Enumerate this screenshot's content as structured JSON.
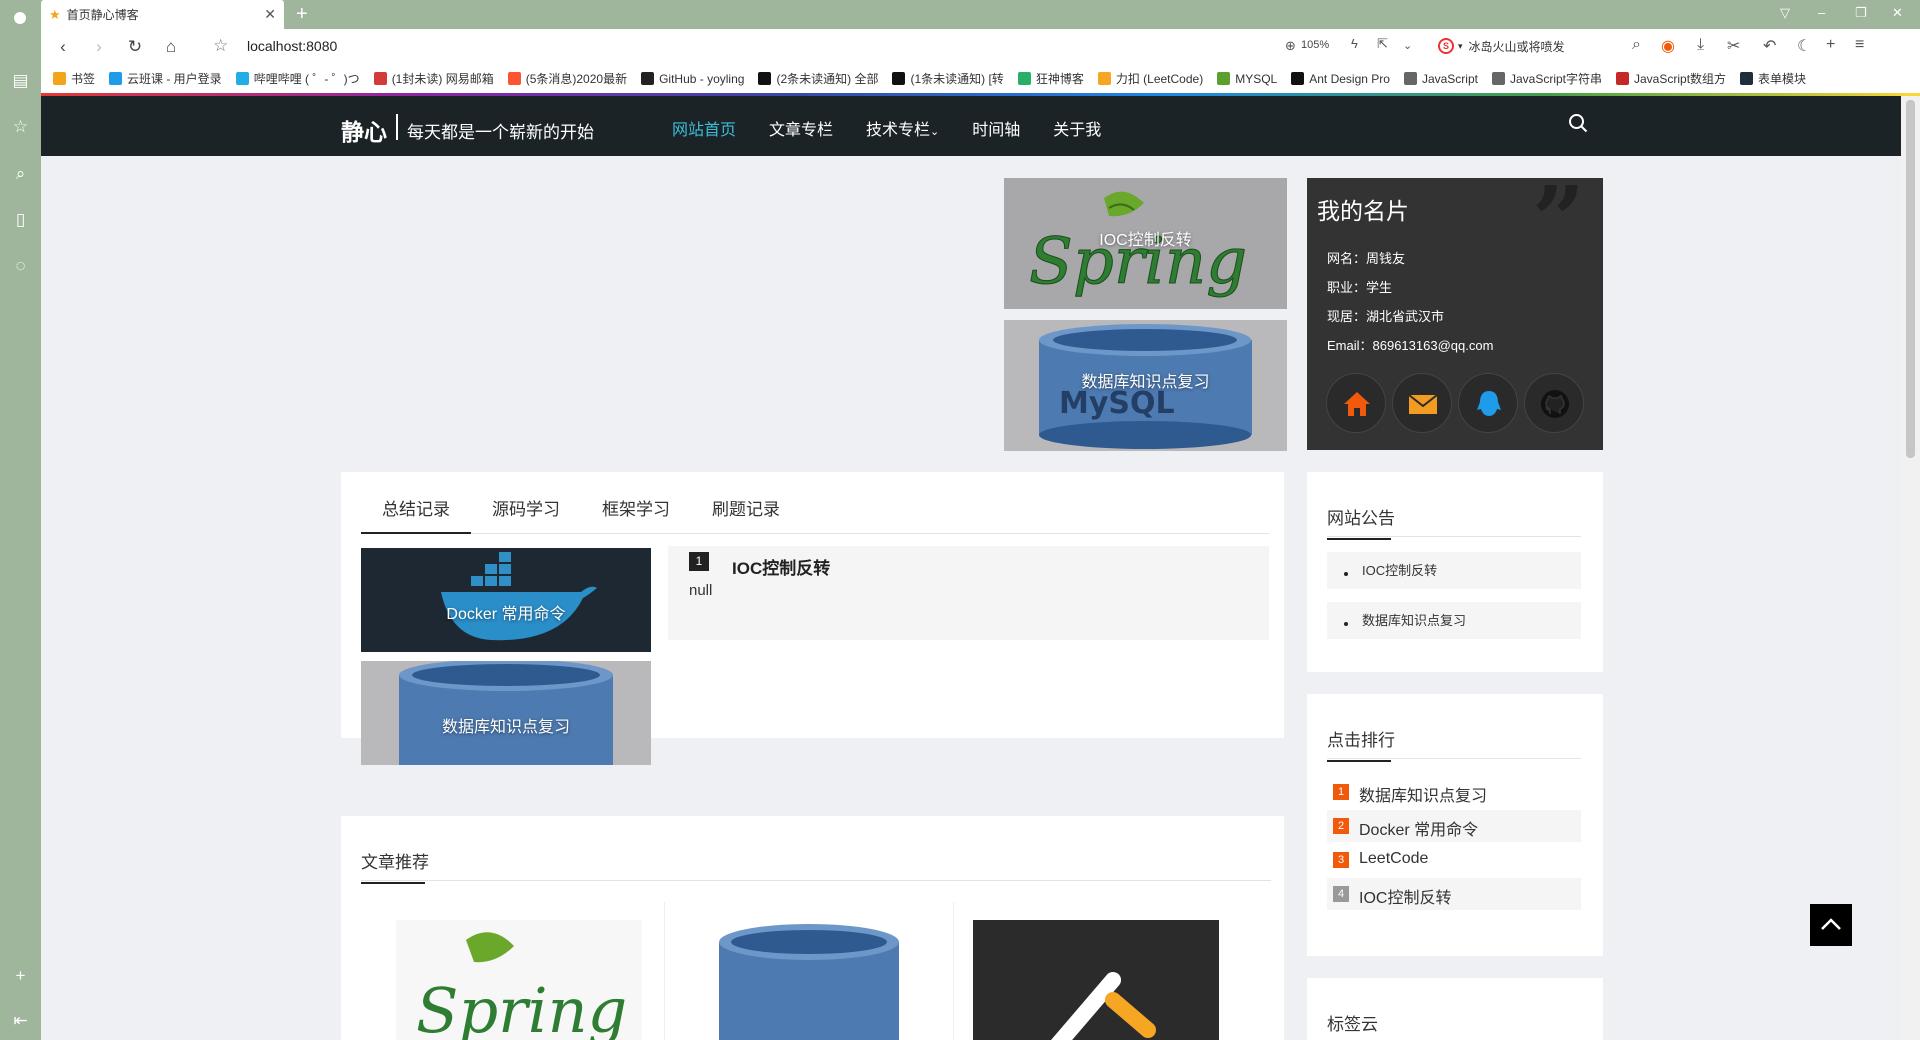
{
  "browser": {
    "tab_title": "首页静心博客",
    "url": "localhost:8080",
    "zoom": "105%",
    "search_engine_text": "冰岛火山或将喷发",
    "bookmarks": [
      {
        "label": "书签",
        "color": "#f2a51a"
      },
      {
        "label": "云班课 - 用户登录",
        "color": "#1e9be9"
      },
      {
        "label": "哔哩哔哩 ( ゜- ゜)つ",
        "color": "#23ade5"
      },
      {
        "label": "(1封未读) 网易邮箱",
        "color": "#d23b38"
      },
      {
        "label": "(5条消息)2020最新",
        "color": "#fc5531"
      },
      {
        "label": "GitHub - yoyling",
        "color": "#222222"
      },
      {
        "label": "(2条未读通知) 全部",
        "color": "#111111"
      },
      {
        "label": "(1条未读通知) [转",
        "color": "#111111"
      },
      {
        "label": "狂神博客",
        "color": "#2aae67"
      },
      {
        "label": "力扣 (LeetCode)",
        "color": "#f5a623"
      },
      {
        "label": "MYSQL",
        "color": "#5aa02c"
      },
      {
        "label": "Ant Design Pro",
        "color": "#111111"
      },
      {
        "label": "JavaScript",
        "color": "#666666"
      },
      {
        "label": "JavaScript字符串",
        "color": "#666666"
      },
      {
        "label": "JavaScript数组方",
        "color": "#c62828"
      },
      {
        "label": "表单模块",
        "color": "#1f2d3d"
      }
    ]
  },
  "site": {
    "brand": "静心",
    "slogan": "每天都是一个崭新的开始",
    "nav": [
      "网站首页",
      "文章专栏",
      "技术专栏",
      "时间轴",
      "关于我"
    ],
    "nav_dropdown_mark": "⌄"
  },
  "hero": {
    "items": [
      "IOC控制反转",
      "数据库知识点复习"
    ]
  },
  "profile": {
    "title": "我的名片",
    "rows": [
      "网名：周钱友",
      "职业：学生",
      "现居：湖北省武汉市",
      "Email：869613163@qq.com"
    ],
    "social_icons": [
      "home-icon",
      "mail-icon",
      "qq-icon",
      "github-icon"
    ],
    "social_colors": [
      "#f15a0a",
      "#f39c1f",
      "#1e9be9",
      "#222222"
    ]
  },
  "category_tabs": {
    "tabs": [
      "总结记录",
      "源码学习",
      "框架学习",
      "刷题记录"
    ],
    "thumbs": [
      "Docker 常用命令",
      "数据库知识点复习"
    ],
    "article": {
      "rank": "1",
      "title": "IOC控制反转",
      "summary": "null"
    }
  },
  "recommend": {
    "title": "文章推荐"
  },
  "notice": {
    "title": "网站公告",
    "items": [
      "IOC控制反转",
      "数据库知识点复习"
    ]
  },
  "hot": {
    "title": "点击排行",
    "items": [
      {
        "rank": "1",
        "label": "数据库知识点复习",
        "color": "#f15a0a"
      },
      {
        "rank": "2",
        "label": "Docker 常用命令",
        "color": "#f15a0a"
      },
      {
        "rank": "3",
        "label": "LeetCode",
        "color": "#f15a0a"
      },
      {
        "rank": "4",
        "label": "IOC控制反转",
        "color": "#999999"
      }
    ]
  },
  "tags": {
    "title": "标签云"
  }
}
